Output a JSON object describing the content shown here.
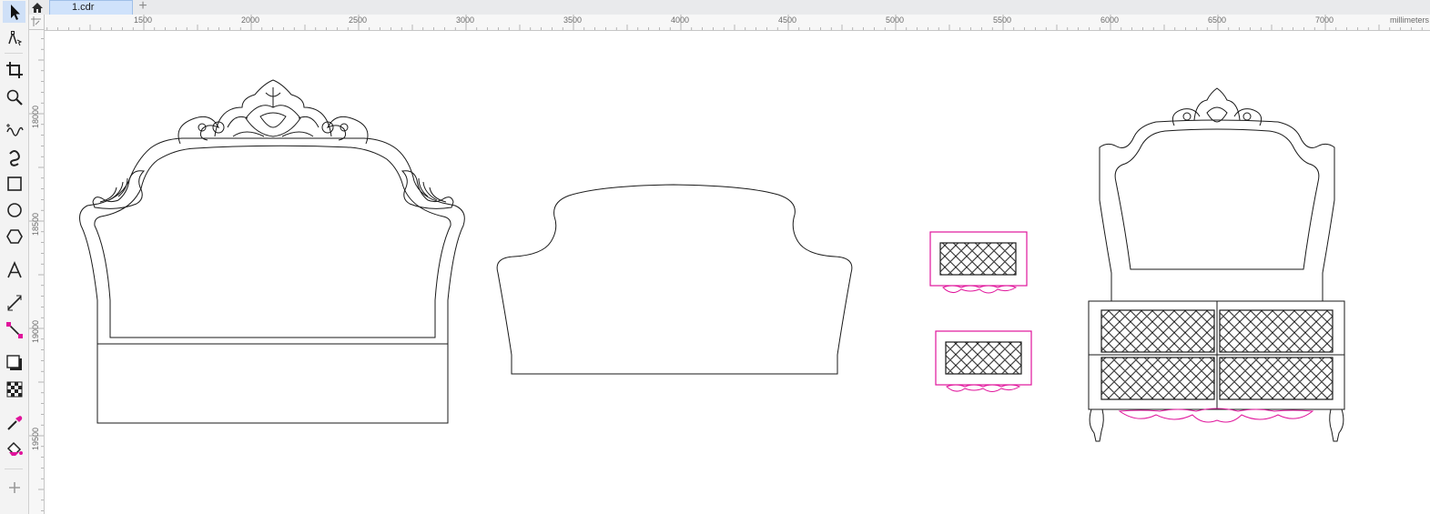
{
  "tabs": {
    "home_icon": "home-icon",
    "document": "1.cdr",
    "add_icon": "plus-icon"
  },
  "toolbox": [
    {
      "name": "pick-tool",
      "icon": "arrow-pointer-icon"
    },
    {
      "name": "shape-tool",
      "icon": "node-edit-icon"
    },
    {
      "name": "crop-tool",
      "icon": "crop-icon"
    },
    {
      "name": "zoom-tool",
      "icon": "magnifier-icon"
    },
    {
      "name": "freehand-tool",
      "icon": "freehand-icon"
    },
    {
      "name": "artistic-media-tool",
      "icon": "artistic-media-icon"
    },
    {
      "name": "rectangle-tool",
      "icon": "rectangle-icon"
    },
    {
      "name": "ellipse-tool",
      "icon": "ellipse-icon"
    },
    {
      "name": "polygon-tool",
      "icon": "polygon-icon"
    },
    {
      "name": "text-tool",
      "icon": "text-icon"
    },
    {
      "name": "dimension-tool",
      "icon": "dimension-icon"
    },
    {
      "name": "connector-tool",
      "icon": "connector-icon"
    },
    {
      "name": "drop-shadow-tool",
      "icon": "drop-shadow-icon"
    },
    {
      "name": "transparency-tool",
      "icon": "transparency-icon"
    },
    {
      "name": "eyedropper-tool",
      "icon": "eyedropper-icon"
    },
    {
      "name": "interactive-fill-tool",
      "icon": "fill-bucket-icon"
    },
    {
      "name": "add-tool",
      "icon": "plus-icon"
    }
  ],
  "ruler": {
    "top_labels": [
      "1500",
      "2000",
      "2500",
      "3000",
      "3500",
      "4000",
      "4500",
      "5000",
      "5500",
      "6000",
      "6500",
      "7000"
    ],
    "unit": "millimeters",
    "left_labels": [
      "18000",
      "18500",
      "19000",
      "19500"
    ]
  },
  "colors": {
    "outline": "#1a1a1a",
    "magenta": "#e0149b",
    "ruler_bg": "#f7f7f7",
    "tab_active": "#cfe2fb",
    "tool_selected": "#cfe0f7"
  }
}
